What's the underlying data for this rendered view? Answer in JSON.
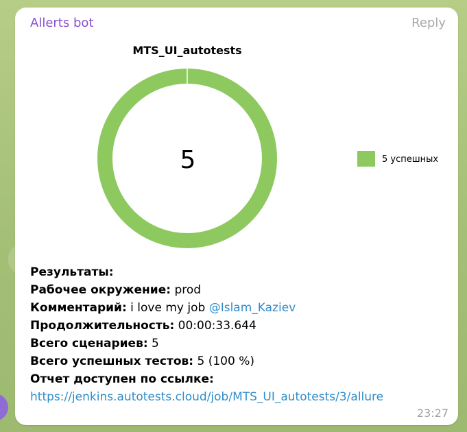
{
  "message": {
    "sender": "Allerts bot",
    "reply_label": "Reply",
    "time": "23:27"
  },
  "chart_data": {
    "type": "pie",
    "title": "MTS_UI_autotests",
    "center_label": "5",
    "slices": [
      {
        "label": "5 успешных",
        "value": 5,
        "color": "#8dc95f"
      }
    ],
    "legend_position": "right"
  },
  "results": {
    "heading": "Результаты:",
    "env_label": "Рабочее окружение:",
    "env_value": "prod",
    "comment_label": "Комментарий:",
    "comment_value": "i love my job",
    "comment_mention": "@Islam_Kaziev",
    "duration_label": "Продолжительность:",
    "duration_value": "00:00:33.644",
    "scenarios_label": "Всего сценариев:",
    "scenarios_value": "5",
    "passed_label": "Всего успешных тестов:",
    "passed_value": "5 (100 %)",
    "report_label": "Отчет доступен по ссылке:",
    "report_url": "https://jenkins.autotests.cloud/job/MTS_UI_autotests/3/allure"
  }
}
